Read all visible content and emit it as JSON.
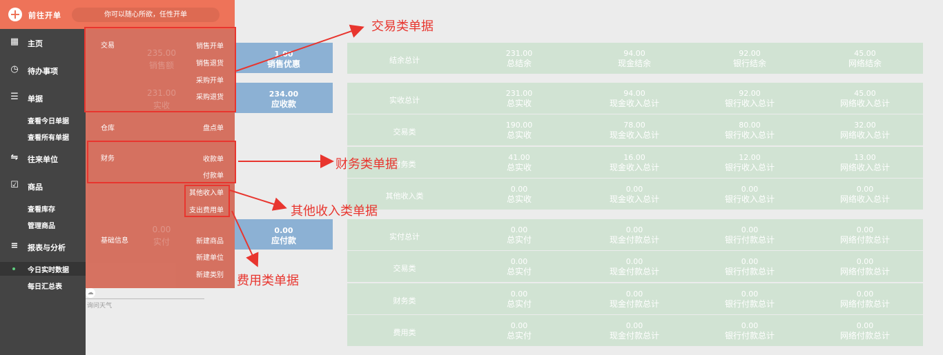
{
  "topbar": {
    "new_label": "前往开单",
    "slogan": "你可以随心所欲，任性开单"
  },
  "sidebar": {
    "items": [
      {
        "icon": "grid-icon",
        "label": "主页"
      },
      {
        "icon": "clock-icon",
        "label": "待办事项"
      },
      {
        "icon": "list-icon",
        "label": "单据"
      },
      {
        "icon": "swap-icon",
        "label": "往来单位"
      },
      {
        "icon": "checkbox-icon",
        "label": "商品"
      },
      {
        "icon": "bars-icon",
        "label": "报表与分析"
      }
    ],
    "sub": {
      "docs_today": "查看今日单据",
      "docs_all": "查看所有单据",
      "stock": "查看库存",
      "goods_manage": "管理商品",
      "today_data": "今日实时数据",
      "daily_summary": "每日汇总表"
    }
  },
  "dropdown": {
    "trade": {
      "head": "交易",
      "items": [
        "销售开单",
        "销售退货",
        "采购开单",
        "采购退货"
      ]
    },
    "warehouse": {
      "head": "仓库",
      "items": [
        "盘点单"
      ]
    },
    "finance": {
      "head": "财务",
      "items": [
        "收款单",
        "付款单"
      ]
    },
    "other": {
      "items": [
        "其他收入单",
        "支出费用单"
      ]
    },
    "basic": {
      "head": "基础信息",
      "items": [
        "新建商品",
        "新建单位",
        "新建类别"
      ]
    },
    "ghost": {
      "g1": "235.00",
      "g2": "销售额",
      "g3": "231.00",
      "g4": "实收",
      "g5": "0.00",
      "g6": "实付"
    }
  },
  "weather": {
    "label": "询问天气"
  },
  "blue": [
    {
      "value": "1.00",
      "label": "销售优惠"
    },
    {
      "value": "234.00",
      "label": "应收款"
    },
    {
      "value": "0.00",
      "label": "应付款"
    }
  ],
  "rows": [
    {
      "label": "结余总计",
      "cells": [
        [
          "231.00",
          "总结余"
        ],
        [
          "94.00",
          "现金结余"
        ],
        [
          "92.00",
          "银行结余"
        ],
        [
          "45.00",
          "网络结余"
        ]
      ]
    },
    {
      "label": "实收总计",
      "cells": [
        [
          "231.00",
          "总实收"
        ],
        [
          "94.00",
          "现金收入总计"
        ],
        [
          "92.00",
          "银行收入总计"
        ],
        [
          "45.00",
          "网络收入总计"
        ]
      ]
    },
    {
      "label": "交易类",
      "cells": [
        [
          "190.00",
          "总实收"
        ],
        [
          "78.00",
          "现金收入总计"
        ],
        [
          "80.00",
          "银行收入总计"
        ],
        [
          "32.00",
          "网络收入总计"
        ]
      ]
    },
    {
      "label": "财务类",
      "cells": [
        [
          "41.00",
          "总实收"
        ],
        [
          "16.00",
          "现金收入总计"
        ],
        [
          "12.00",
          "银行收入总计"
        ],
        [
          "13.00",
          "网络收入总计"
        ]
      ]
    },
    {
      "label": "其他收入类",
      "cells": [
        [
          "0.00",
          "总实收"
        ],
        [
          "0.00",
          "现金收入总计"
        ],
        [
          "0.00",
          "银行收入总计"
        ],
        [
          "0.00",
          "网络收入总计"
        ]
      ]
    },
    {
      "label": "实付总计",
      "cells": [
        [
          "0.00",
          "总实付"
        ],
        [
          "0.00",
          "现金付款总计"
        ],
        [
          "0.00",
          "银行付款总计"
        ],
        [
          "0.00",
          "网络付款总计"
        ]
      ]
    },
    {
      "label": "交易类",
      "cells": [
        [
          "0.00",
          "总实付"
        ],
        [
          "0.00",
          "现金付款总计"
        ],
        [
          "0.00",
          "银行付款总计"
        ],
        [
          "0.00",
          "网络付款总计"
        ]
      ]
    },
    {
      "label": "财务类",
      "cells": [
        [
          "0.00",
          "总实付"
        ],
        [
          "0.00",
          "现金付款总计"
        ],
        [
          "0.00",
          "银行付款总计"
        ],
        [
          "0.00",
          "网络付款总计"
        ]
      ]
    },
    {
      "label": "费用类",
      "cells": [
        [
          "0.00",
          "总实付"
        ],
        [
          "0.00",
          "现金付款总计"
        ],
        [
          "0.00",
          "银行付款总计"
        ],
        [
          "0.00",
          "网络付款总计"
        ]
      ]
    }
  ],
  "annotations": {
    "trade": "交易类单据",
    "finance": "财务类单据",
    "other": "其他收入类单据",
    "expense": "费用类单据"
  },
  "colors": {
    "accent": "#ee7359",
    "sidebar": "#444444",
    "blue": "#8cb1d4",
    "green": "#d1e3d3",
    "annotation": "#e8352e"
  }
}
